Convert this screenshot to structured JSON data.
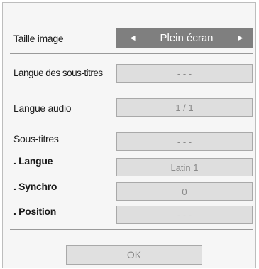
{
  "picture_size": {
    "label": "Taille image",
    "value": "Plein écran",
    "left_arrow": "◄",
    "right_arrow": "►"
  },
  "subtitle_language": {
    "label": "Langue des sous-titres",
    "value": "- - -"
  },
  "audio_language": {
    "label": "Langue audio",
    "value": "1 / 1"
  },
  "subtitles": {
    "label": "Sous-titres",
    "value": "- - -"
  },
  "language": {
    "label": ". Langue",
    "value": "Latin 1"
  },
  "sync": {
    "label": ". Synchro",
    "value": "0"
  },
  "position": {
    "label": ". Position",
    "value": "- - -"
  },
  "ok_button": {
    "label": "OK"
  },
  "colors": {
    "selector_background": "#7f7f7f",
    "field_background": "#dedede",
    "panel_background": "#f6f6f6"
  }
}
